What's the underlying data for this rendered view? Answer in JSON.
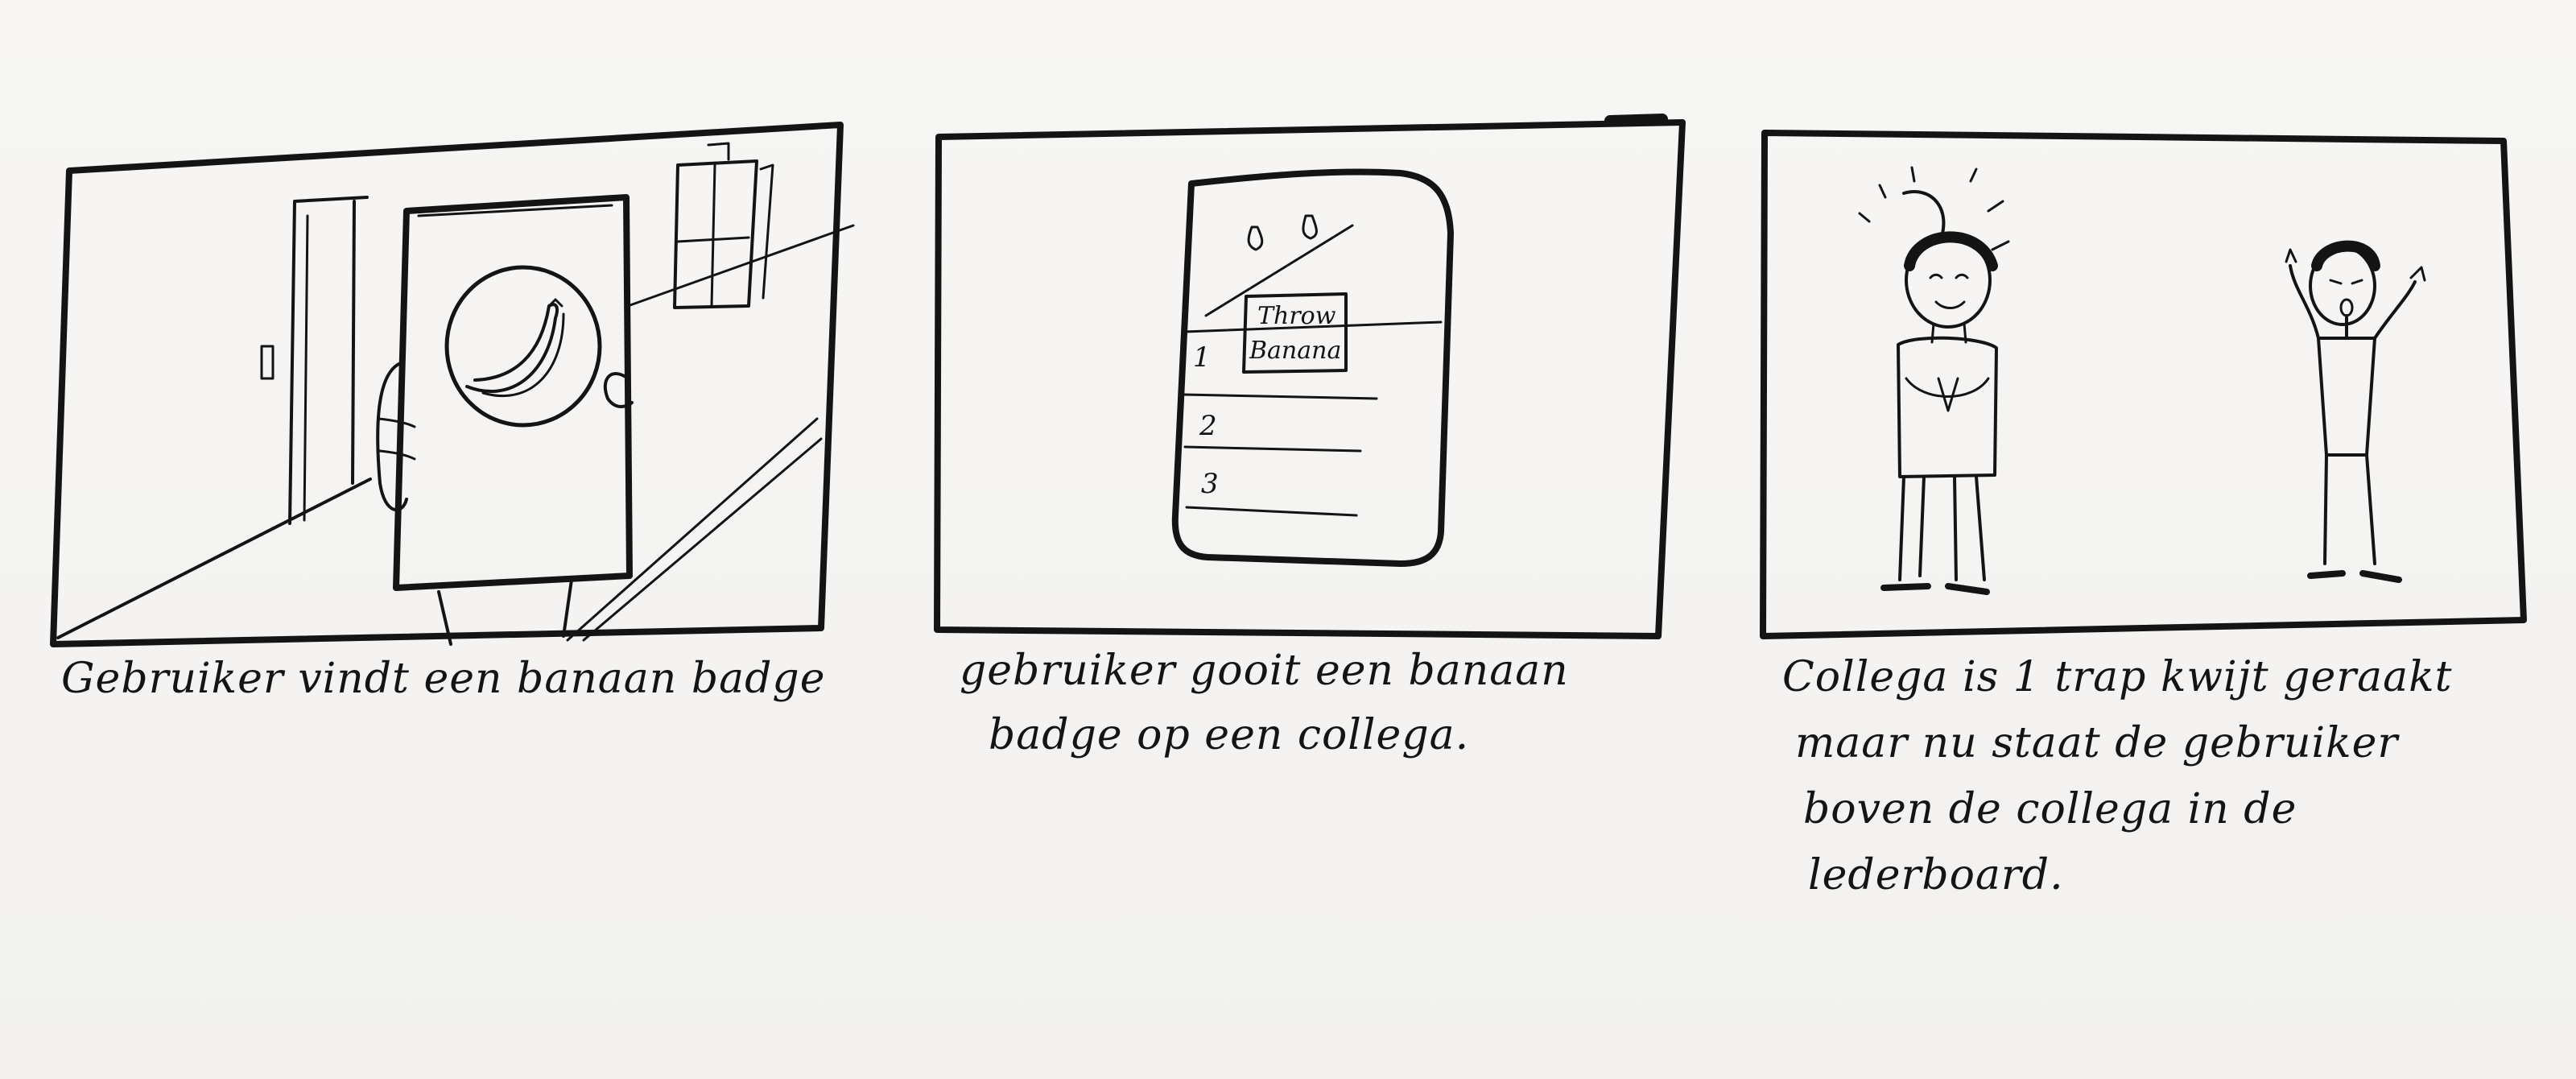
{
  "panels": [
    {
      "caption": "Gebruiker vindt een banaan badge"
    },
    {
      "caption_lines": [
        "gebruiker gooit een banaan",
        "badge op een collega."
      ],
      "phone": {
        "button_label_line1": "Throw",
        "button_label_line2": "Banana",
        "rank_1": "1",
        "rank_2": "2",
        "rank_3": "3"
      }
    },
    {
      "caption_lines": [
        "Collega is 1 trap kwijt geraakt",
        "maar nu staat de gebruiker",
        "boven de collega in de",
        "lederboard."
      ]
    }
  ],
  "colors": {
    "ink": "#141414",
    "paper": "#f5f4f2"
  }
}
